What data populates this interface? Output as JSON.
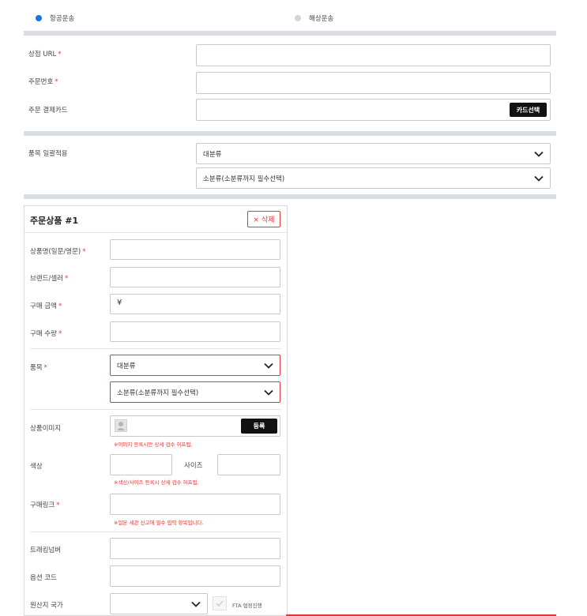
{
  "shipping": {
    "air": "항공운송",
    "sea": "해상운송"
  },
  "top_form": {
    "store_url_label": "상점 URL",
    "order_no_label": "주문번호",
    "payment_card_label": "주문 결제카드",
    "card_select_btn": "카드선택",
    "category_batch_label": "품목 일괄적용",
    "major_category": "대분류",
    "minor_category": "소분류(소분류까지 필수선택)"
  },
  "item": {
    "title": "주문상품 #1",
    "delete_btn": "× 삭제",
    "name_label": "상품명(일문/영문)",
    "brand_label": "브랜드/셀러",
    "price_label": "구매 금액",
    "price_prefix": "¥",
    "qty_label": "구매 수량",
    "category_label": "품목",
    "major_category": "대분류",
    "minor_category": "소분류(소분류까지 필수선택)",
    "image_label": "상품이미지",
    "image_register_btn": "등록",
    "image_hint": "※이미지 등록시만 상세 검수 허프됨.",
    "color_label": "색상",
    "size_label": "사이즈",
    "color_size_hint": "※색상/사이즈 등록시 상세 검수 허프됨.",
    "link_label": "구매링크",
    "link_hint": "※일본 세관 신고에 필수 입력 항목입니다.",
    "tracking_label": "트래킹넘버",
    "option_code_label": "옵션 코드",
    "origin_label": "원산지 국가",
    "fta_label": "FTA 협정진행"
  },
  "required_mark": "*"
}
